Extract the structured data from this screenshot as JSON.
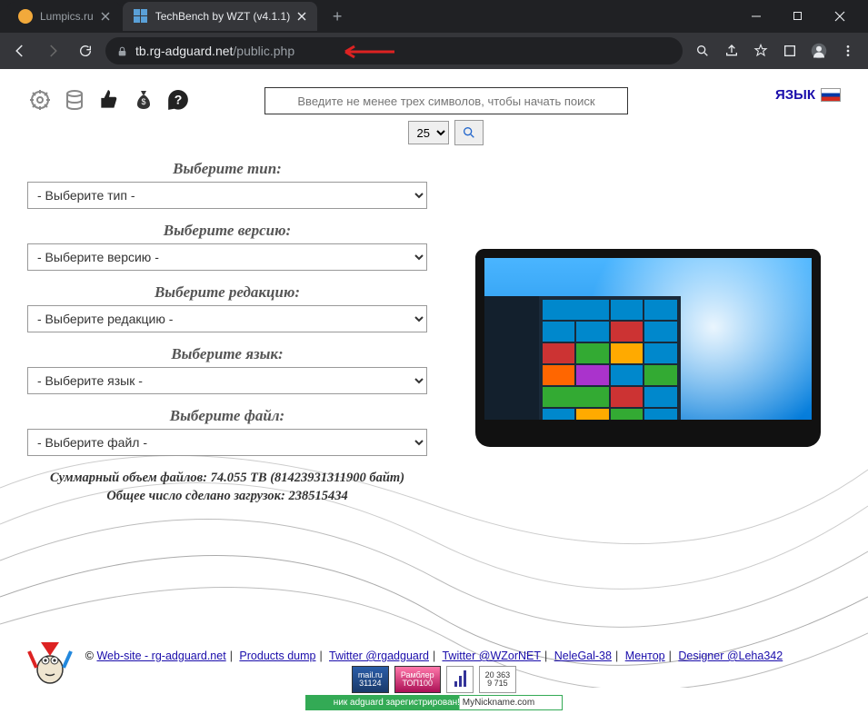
{
  "browser": {
    "tabs": [
      {
        "title": "Lumpics.ru",
        "favicon_color": "#f2a93b"
      },
      {
        "title": "TechBench by WZT (v4.1.1)",
        "favicon_color": "#5aa0d8"
      }
    ],
    "url_prefix": "tb.rg-adguard.net",
    "url_suffix": "/public.php"
  },
  "search": {
    "placeholder": "Введите не менее трех символов, чтобы начать поиск",
    "count": "25"
  },
  "lang_label": "ЯЗЫК",
  "selectors": {
    "type": {
      "label": "Выберите тип:",
      "value": "- Выберите тип -"
    },
    "version": {
      "label": "Выберите версию:",
      "value": "- Выберите версию -"
    },
    "edition": {
      "label": "Выберите редакцию:",
      "value": "- Выберите редакцию -"
    },
    "lang": {
      "label": "Выберите язык:",
      "value": "- Выберите язык -"
    },
    "file": {
      "label": "Выберите файл:",
      "value": "- Выберите файл -"
    }
  },
  "stats": {
    "total_label": "Суммарный объем файлов:",
    "total_value": "74.055 TB (81423931311900 байт)",
    "downloads_label": "Общее число сделано загрузок:",
    "downloads_value": "238515434"
  },
  "footer": {
    "copy": "©",
    "links1": [
      "Web-site - rg-adguard.net",
      "Products dump",
      "Twitter @rgadguard",
      "Twitter @WZorNET",
      "NeleGal-38",
      "Ментор",
      "Designer @Leha342"
    ],
    "badge_mailru_top": "mail.ru",
    "badge_mailru_bottom": "31124",
    "badge_rambler_top": "Рамблер",
    "badge_rambler_bottom": "ТОП100",
    "badge_num_top": "20 363",
    "badge_num_bottom": "9 715",
    "nick_left": "ник adguard зарегистрирован!",
    "nick_right": "MyNickname.com"
  }
}
